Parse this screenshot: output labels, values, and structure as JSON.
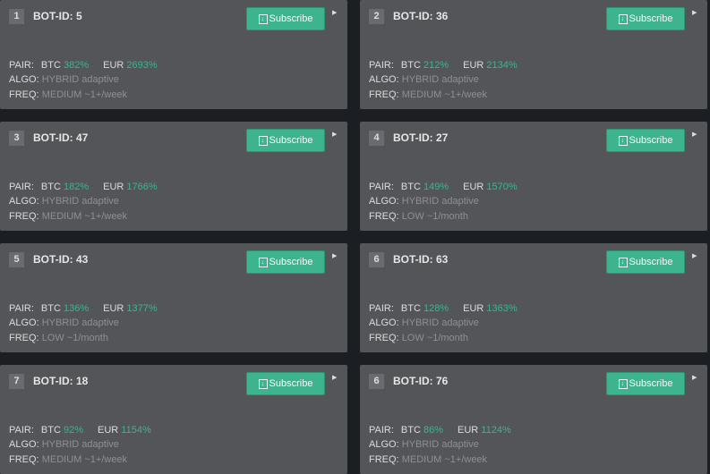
{
  "labels": {
    "pair": "PAIR:",
    "algo": "ALGO:",
    "freq": "FREQ:",
    "btc": "BTC",
    "eur": "EUR",
    "subscribe": "Subscribe"
  },
  "bots": [
    {
      "rank": "1",
      "title": "BOT-ID: 5",
      "btc": "382%",
      "eur": "2693%",
      "algo": "HYBRID adaptive",
      "freq": "MEDIUM ~1+/week"
    },
    {
      "rank": "2",
      "title": "BOT-ID: 36",
      "btc": "212%",
      "eur": "2134%",
      "algo": "HYBRID adaptive",
      "freq": "MEDIUM ~1+/week"
    },
    {
      "rank": "3",
      "title": "BOT-ID: 47",
      "btc": "182%",
      "eur": "1766%",
      "algo": "HYBRID adaptive",
      "freq": "MEDIUM ~1+/week"
    },
    {
      "rank": "4",
      "title": "BOT-ID: 27",
      "btc": "149%",
      "eur": "1570%",
      "algo": "HYBRID adaptive",
      "freq": "LOW ~1/month"
    },
    {
      "rank": "5",
      "title": "BOT-ID: 43",
      "btc": "136%",
      "eur": "1377%",
      "algo": "HYBRID adaptive",
      "freq": "LOW ~1/month"
    },
    {
      "rank": "6",
      "title": "BOT-ID: 63",
      "btc": "128%",
      "eur": "1363%",
      "algo": "HYBRID adaptive",
      "freq": "LOW ~1/month"
    },
    {
      "rank": "7",
      "title": "BOT-ID: 18",
      "btc": "92%",
      "eur": "1154%",
      "algo": "HYBRID adaptive",
      "freq": "MEDIUM ~1+/week"
    },
    {
      "rank": "6",
      "title": "BOT-ID: 76",
      "btc": "86%",
      "eur": "1124%",
      "algo": "HYBRID adaptive",
      "freq": "MEDIUM ~1+/week"
    }
  ]
}
